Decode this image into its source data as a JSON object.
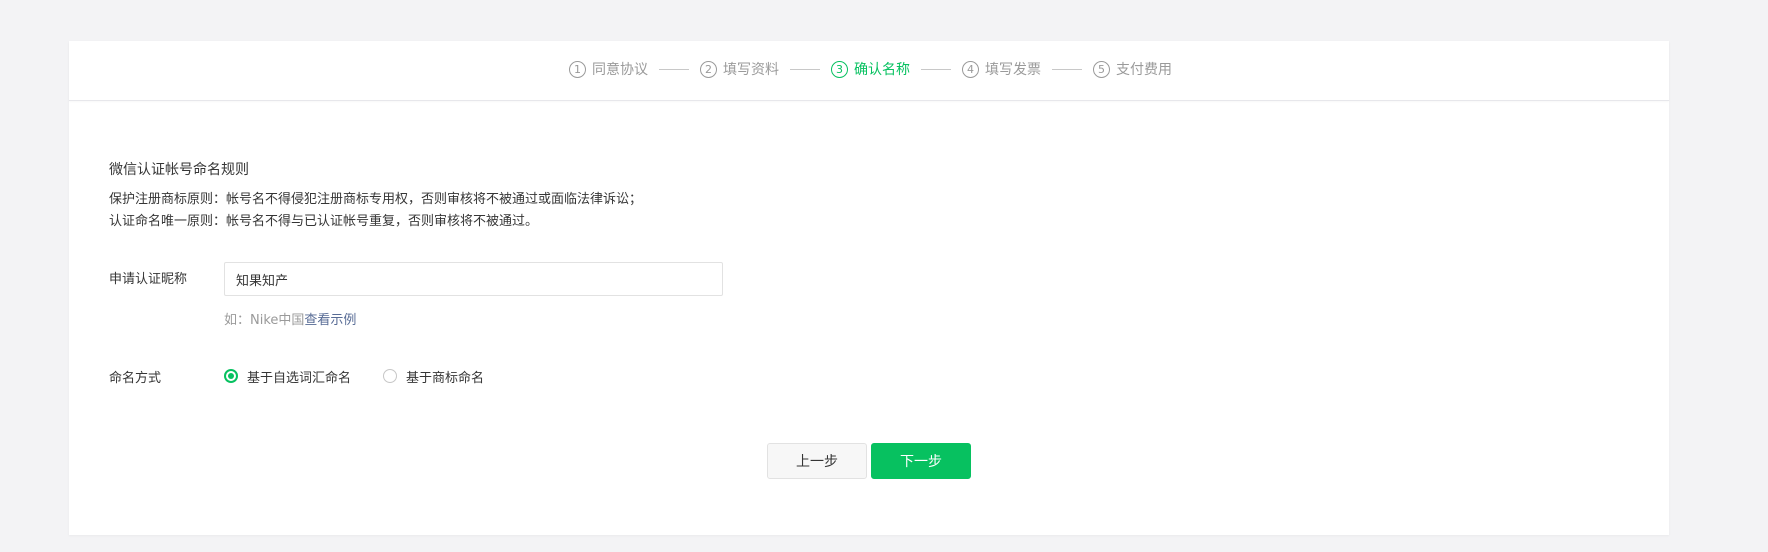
{
  "steps": [
    {
      "num": "1",
      "label": "同意协议",
      "active": false
    },
    {
      "num": "2",
      "label": "填写资料",
      "active": false
    },
    {
      "num": "3",
      "label": "确认名称",
      "active": true
    },
    {
      "num": "4",
      "label": "填写发票",
      "active": false
    },
    {
      "num": "5",
      "label": "支付费用",
      "active": false
    }
  ],
  "rules": {
    "title": "微信认证帐号命名规则",
    "line1": "保护注册商标原则：帐号名不得侵犯注册商标专用权，否则审核将不被通过或面临法律诉讼；",
    "line2": "认证命名唯一原则：帐号名不得与已认证帐号重复，否则审核将不被通过。"
  },
  "name_field": {
    "label": "申请认证昵称",
    "value": "知果知产",
    "hint_prefix": "如：Nike中国",
    "hint_link": "查看示例"
  },
  "method": {
    "label": "命名方式",
    "options": [
      {
        "label": "基于自选词汇命名",
        "checked": true
      },
      {
        "label": "基于商标命名",
        "checked": false
      }
    ]
  },
  "buttons": {
    "prev": "上一步",
    "next": "下一步"
  },
  "colors": {
    "accent": "#07c160",
    "link": "#576b95",
    "muted": "#9a9a9a"
  }
}
